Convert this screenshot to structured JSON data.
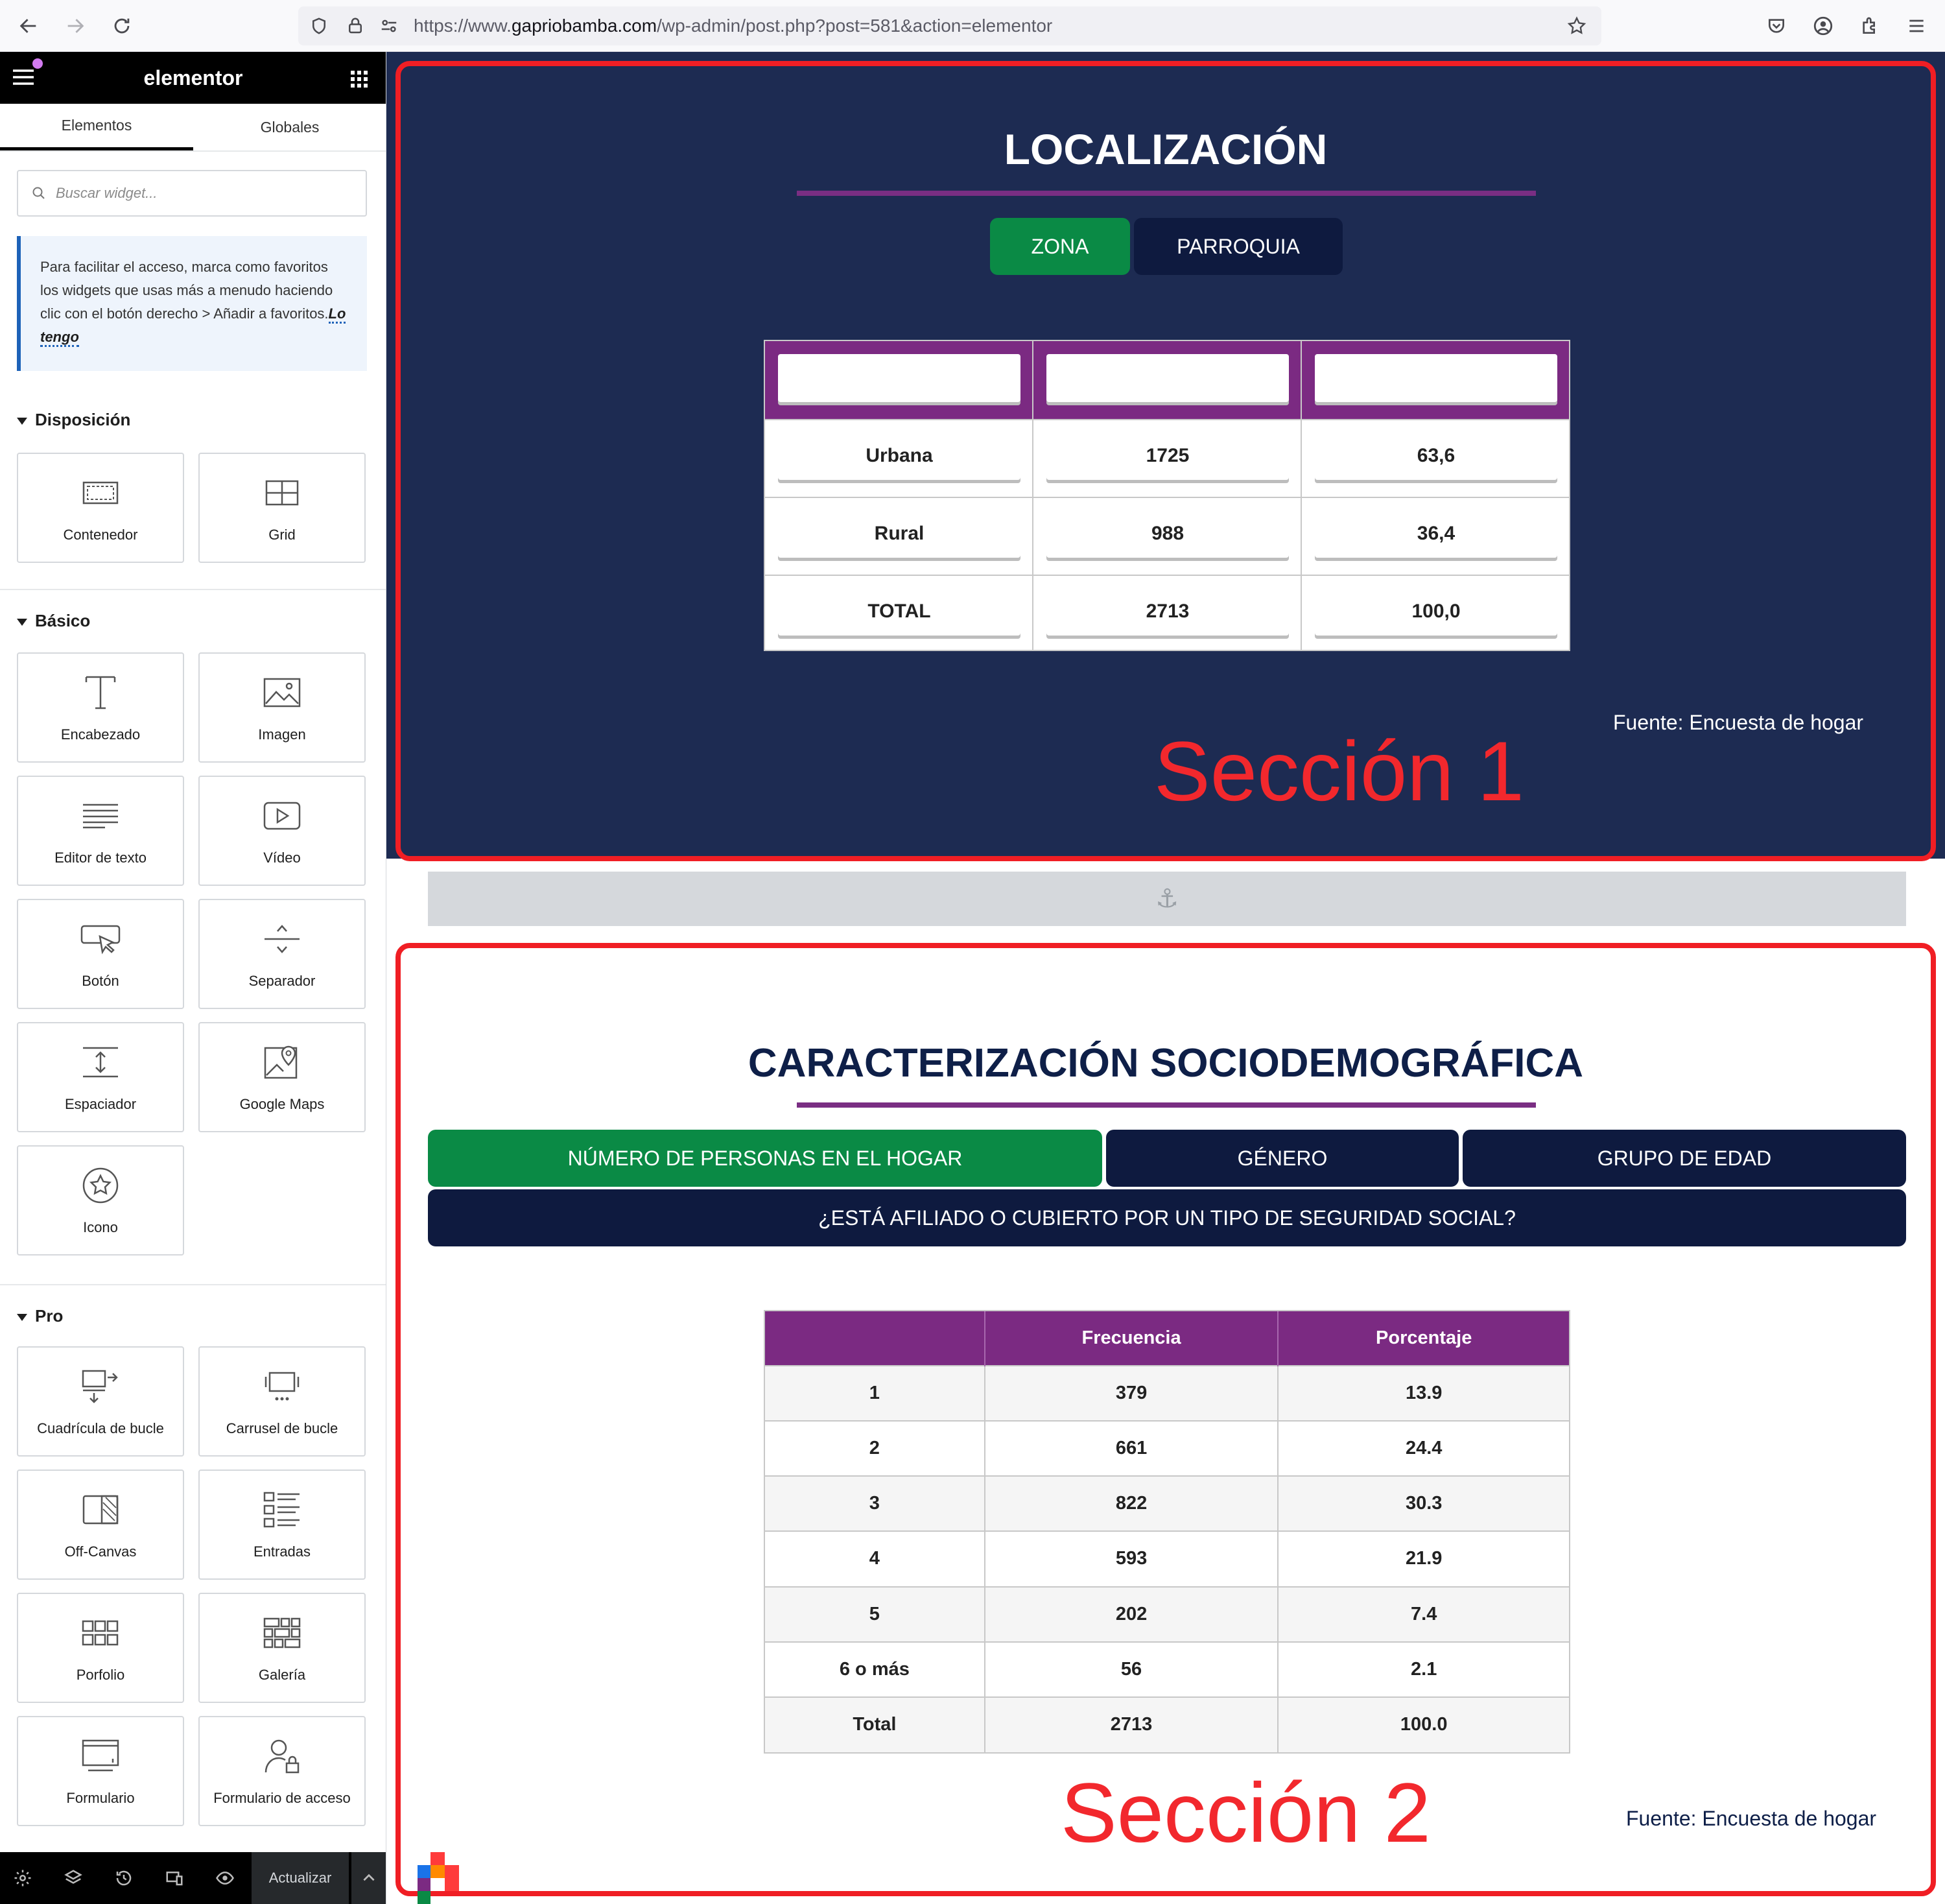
{
  "browser": {
    "url_prefix": "https://www.",
    "url_domain": "gapriobamba.com",
    "url_path": "/wp-admin/post.php?post=581&action=elementor",
    "icons": [
      "back-icon",
      "forward-icon",
      "reload-icon",
      "shield-icon",
      "lock-icon",
      "permissions-icon",
      "bookmark-star-icon",
      "pocket-icon",
      "account-icon",
      "extensions-icon",
      "menu-icon"
    ]
  },
  "sidebar": {
    "brand": "elementor",
    "tabs": [
      "Elementos",
      "Globales"
    ],
    "search_placeholder": "Buscar widget...",
    "notice_text": "Para facilitar el acceso, marca como favoritos los widgets que usas más a menudo haciendo clic con el botón derecho > Añadir a favoritos.",
    "notice_link": "Lo tengo",
    "categories": {
      "layout": {
        "title": "Disposición",
        "widgets": [
          {
            "label": "Contenedor",
            "icon": "container-icon"
          },
          {
            "label": "Grid",
            "icon": "grid-icon"
          }
        ]
      },
      "basic": {
        "title": "Básico",
        "widgets": [
          {
            "label": "Encabezado",
            "icon": "heading-icon"
          },
          {
            "label": "Imagen",
            "icon": "image-icon"
          },
          {
            "label": "Editor de texto",
            "icon": "text-editor-icon"
          },
          {
            "label": "Vídeo",
            "icon": "video-icon"
          },
          {
            "label": "Botón",
            "icon": "button-icon"
          },
          {
            "label": "Separador",
            "icon": "divider-icon"
          },
          {
            "label": "Espaciador",
            "icon": "spacer-icon"
          },
          {
            "label": "Google Maps",
            "icon": "google-maps-icon"
          },
          {
            "label": "Icono",
            "icon": "star-icon"
          }
        ]
      },
      "pro": {
        "title": "Pro",
        "widgets": [
          {
            "label": "Cuadrícula de bucle",
            "icon": "loop-grid-icon"
          },
          {
            "label": "Carrusel de bucle",
            "icon": "loop-carousel-icon"
          },
          {
            "label": "Off-Canvas",
            "icon": "off-canvas-icon"
          },
          {
            "label": "Entradas",
            "icon": "posts-icon"
          },
          {
            "label": "Porfolio",
            "icon": "portfolio-icon"
          },
          {
            "label": "Galería",
            "icon": "gallery-icon"
          },
          {
            "label": "Formulario",
            "icon": "form-icon"
          },
          {
            "label": "Formulario de acceso",
            "icon": "login-icon"
          }
        ]
      }
    },
    "footer": {
      "update_label": "Actualizar"
    }
  },
  "section1": {
    "title": "LOCALIZACIÓN",
    "tabs": [
      {
        "label": "ZONA",
        "active": true
      },
      {
        "label": "PARROQUIA",
        "active": false
      }
    ],
    "table": {
      "headers": [
        "",
        "",
        ""
      ],
      "rows": [
        [
          "Urbana",
          "1725",
          "63,6"
        ],
        [
          "Rural",
          "988",
          "36,4"
        ],
        [
          "TOTAL",
          "2713",
          "100,0"
        ]
      ]
    },
    "source": "Fuente: Encuesta de hogar",
    "annotation": "Sección 1"
  },
  "section2": {
    "title": "CARACTERIZACIÓN SOCIODEMOGRÁFICA",
    "tabs": [
      {
        "label": "NÚMERO DE PERSONAS EN EL HOGAR",
        "active": true
      },
      {
        "label": "GÉNERO",
        "active": false
      },
      {
        "label": "GRUPO DE EDAD",
        "active": false
      },
      {
        "label": "¿ESTÁ AFILIADO O CUBIERTO POR UN TIPO DE SEGURIDAD SOCIAL?",
        "active": false
      }
    ],
    "table": {
      "headers": [
        "",
        "Frecuencia",
        "Porcentaje"
      ],
      "rows": [
        [
          "1",
          "379",
          "13.9"
        ],
        [
          "2",
          "661",
          "24.4"
        ],
        [
          "3",
          "822",
          "30.3"
        ],
        [
          "4",
          "593",
          "21.9"
        ],
        [
          "5",
          "202",
          "7.4"
        ],
        [
          "6 o más",
          "56",
          "2.1"
        ],
        [
          "Total",
          "2713",
          "100.0"
        ]
      ]
    },
    "source": "Fuente: Encuesta de hogar",
    "annotation": "Sección 2"
  },
  "colors": {
    "section_bg": "#1d2b52",
    "accent_purple": "#7b2a82",
    "active_tab": "#0a8a45",
    "inactive_tab": "#0e1a3f",
    "annotation_red": "#f01e24"
  }
}
